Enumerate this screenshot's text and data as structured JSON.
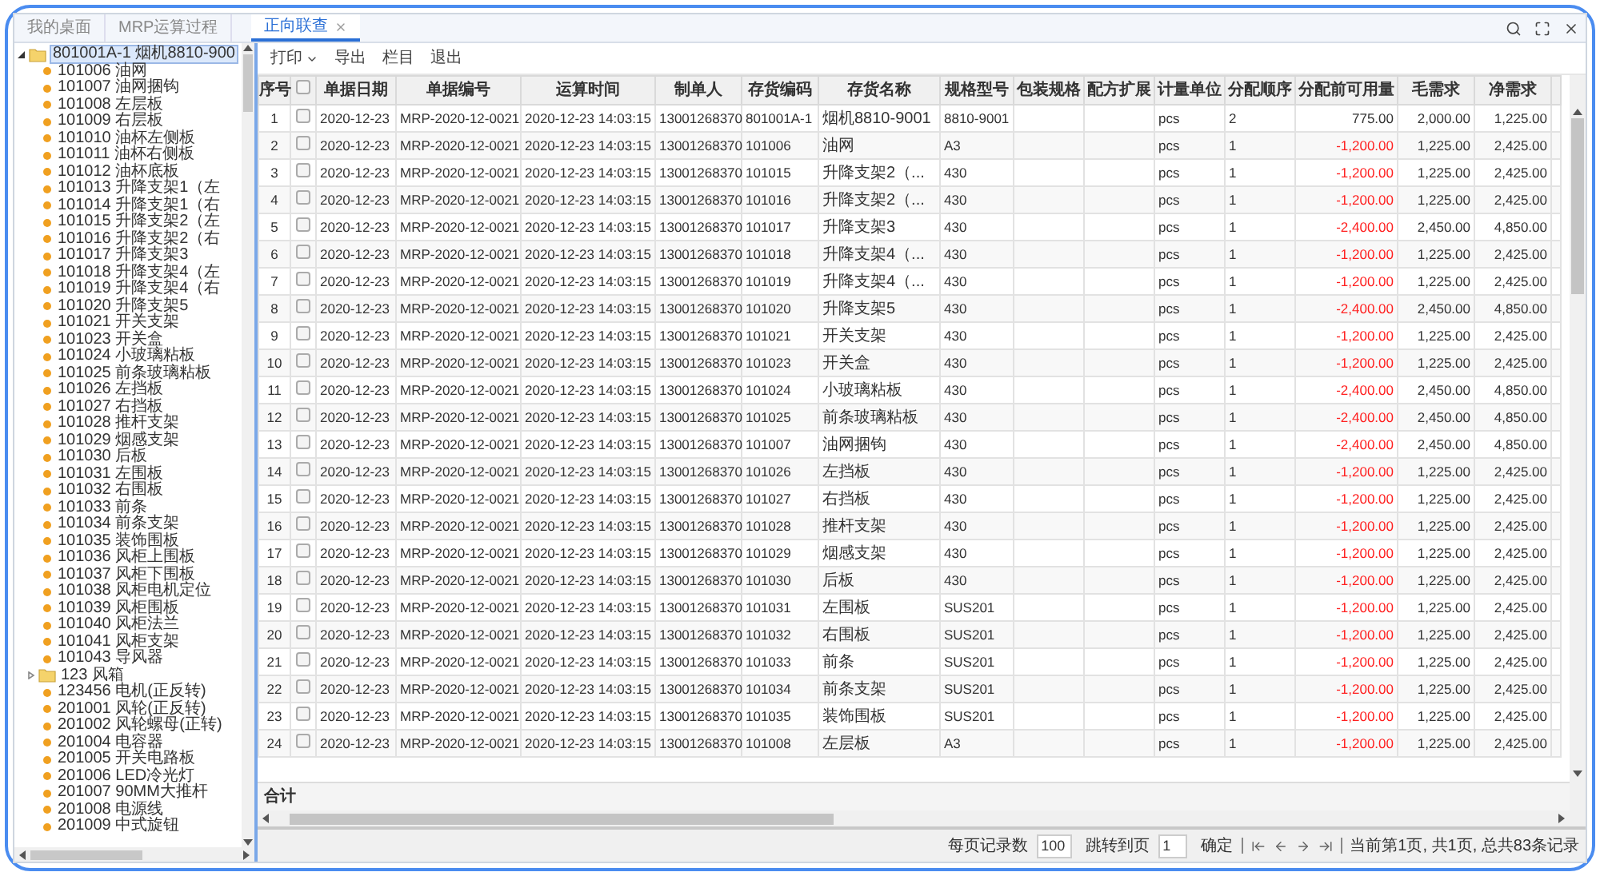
{
  "tabs": [
    {
      "label": "我的桌面",
      "selected": false,
      "closable": false
    },
    {
      "label": "MRP运算过程",
      "selected": false,
      "closable": false
    },
    {
      "label": "正向联查",
      "selected": true,
      "closable": true
    }
  ],
  "toolbar": [
    {
      "label": "打印",
      "dropdown": true
    },
    {
      "label": "导出",
      "dropdown": false
    },
    {
      "label": "栏目",
      "dropdown": false
    },
    {
      "label": "退出",
      "dropdown": false
    }
  ],
  "tree": {
    "label": "801001A-1 烟机8810-900",
    "kind": "folder",
    "expanded": true,
    "selected": true,
    "children": [
      {
        "label": "101006 油网",
        "kind": "item"
      },
      {
        "label": "101007 油网捆钩",
        "kind": "item"
      },
      {
        "label": "101008 左层板",
        "kind": "item"
      },
      {
        "label": "101009 右层板",
        "kind": "item"
      },
      {
        "label": "101010 油杯左侧板",
        "kind": "item"
      },
      {
        "label": "101011 油杯右侧板",
        "kind": "item"
      },
      {
        "label": "101012 油杯底板",
        "kind": "item"
      },
      {
        "label": "101013 升降支架1（左",
        "kind": "item"
      },
      {
        "label": "101014 升降支架1（右",
        "kind": "item"
      },
      {
        "label": "101015 升降支架2（左",
        "kind": "item"
      },
      {
        "label": "101016 升降支架2（右",
        "kind": "item"
      },
      {
        "label": "101017 升降支架3",
        "kind": "item"
      },
      {
        "label": "101018 升降支架4（左",
        "kind": "item"
      },
      {
        "label": "101019 升降支架4（右",
        "kind": "item"
      },
      {
        "label": "101020 升降支架5",
        "kind": "item"
      },
      {
        "label": "101021 开关支架",
        "kind": "item"
      },
      {
        "label": "101023 开关盒",
        "kind": "item"
      },
      {
        "label": "101024 小玻璃粘板",
        "kind": "item"
      },
      {
        "label": "101025 前条玻璃粘板",
        "kind": "item"
      },
      {
        "label": "101026 左挡板",
        "kind": "item"
      },
      {
        "label": "101027 右挡板",
        "kind": "item"
      },
      {
        "label": "101028 推杆支架",
        "kind": "item"
      },
      {
        "label": "101029 烟感支架",
        "kind": "item"
      },
      {
        "label": "101030 后板",
        "kind": "item"
      },
      {
        "label": "101031 左围板",
        "kind": "item"
      },
      {
        "label": "101032 右围板",
        "kind": "item"
      },
      {
        "label": "101033 前条",
        "kind": "item"
      },
      {
        "label": "101034 前条支架",
        "kind": "item"
      },
      {
        "label": "101035 装饰围板",
        "kind": "item"
      },
      {
        "label": "101036 风柜上围板",
        "kind": "item"
      },
      {
        "label": "101037 风柜下围板",
        "kind": "item"
      },
      {
        "label": "101038 风柜电机定位",
        "kind": "item"
      },
      {
        "label": "101039 风柜围板",
        "kind": "item"
      },
      {
        "label": "101040 风柜法兰",
        "kind": "item"
      },
      {
        "label": "101041 风柜支架",
        "kind": "item"
      },
      {
        "label": "101043 导风器",
        "kind": "item"
      },
      {
        "label": "123 风箱",
        "kind": "folder",
        "expanded": false,
        "selected": false
      },
      {
        "label": "123456 电机(正反转)",
        "kind": "item"
      },
      {
        "label": "201001 风轮(正反转)",
        "kind": "item"
      },
      {
        "label": "201002 风轮螺母(正转)",
        "kind": "item"
      },
      {
        "label": "201004 电容器",
        "kind": "item"
      },
      {
        "label": "201005 开关电路板",
        "kind": "item"
      },
      {
        "label": "201006 LED冷光灯",
        "kind": "item"
      },
      {
        "label": "201007 90MM大推杆",
        "kind": "item"
      },
      {
        "label": "201008 电源线",
        "kind": "item"
      },
      {
        "label": "201009 中式旋钮",
        "kind": "item"
      }
    ]
  },
  "table": {
    "columns": [
      "序号",
      "单据日期",
      "单据编号",
      "运算时间",
      "制单人",
      "存货编码",
      "存货名称",
      "规格型号",
      "包装规格",
      "配方扩展",
      "计量单位",
      "分配顺序",
      "分配前可用量",
      "毛需求",
      "净需求"
    ],
    "select_all": {
      "checked": false
    },
    "rows": [
      {
        "no": "1",
        "checked": false,
        "date": "2020-12-23",
        "doc_no": "MRP-2020-12-0021",
        "run_time": "2020-12-23 14:03:15",
        "maker": "13001268370",
        "code": "801001A-1",
        "name": "烟机8810-9001",
        "spec": "8810-9001",
        "unit": "pcs",
        "order": "2",
        "available": "775.00",
        "shortage": false,
        "gross": "2,000.00",
        "net": "1,225.00"
      },
      {
        "no": "2",
        "checked": false,
        "date": "2020-12-23",
        "doc_no": "MRP-2020-12-0021",
        "run_time": "2020-12-23 14:03:15",
        "maker": "13001268370",
        "code": "101006",
        "name": "油网",
        "spec": "A3",
        "unit": "pcs",
        "order": "1",
        "available": "-1,200.00",
        "shortage": true,
        "gross": "1,225.00",
        "net": "2,425.00"
      },
      {
        "no": "3",
        "checked": false,
        "date": "2020-12-23",
        "doc_no": "MRP-2020-12-0021",
        "run_time": "2020-12-23 14:03:15",
        "maker": "13001268370",
        "code": "101015",
        "name": "升降支架2（...",
        "spec": "430",
        "unit": "pcs",
        "order": "1",
        "available": "-1,200.00",
        "shortage": true,
        "gross": "1,225.00",
        "net": "2,425.00"
      },
      {
        "no": "4",
        "checked": false,
        "date": "2020-12-23",
        "doc_no": "MRP-2020-12-0021",
        "run_time": "2020-12-23 14:03:15",
        "maker": "13001268370",
        "code": "101016",
        "name": "升降支架2（...",
        "spec": "430",
        "unit": "pcs",
        "order": "1",
        "available": "-1,200.00",
        "shortage": true,
        "gross": "1,225.00",
        "net": "2,425.00"
      },
      {
        "no": "5",
        "checked": false,
        "date": "2020-12-23",
        "doc_no": "MRP-2020-12-0021",
        "run_time": "2020-12-23 14:03:15",
        "maker": "13001268370",
        "code": "101017",
        "name": "升降支架3",
        "spec": "430",
        "unit": "pcs",
        "order": "1",
        "available": "-2,400.00",
        "shortage": true,
        "gross": "2,450.00",
        "net": "4,850.00"
      },
      {
        "no": "6",
        "checked": false,
        "date": "2020-12-23",
        "doc_no": "MRP-2020-12-0021",
        "run_time": "2020-12-23 14:03:15",
        "maker": "13001268370",
        "code": "101018",
        "name": "升降支架4（...",
        "spec": "430",
        "unit": "pcs",
        "order": "1",
        "available": "-1,200.00",
        "shortage": true,
        "gross": "1,225.00",
        "net": "2,425.00"
      },
      {
        "no": "7",
        "checked": false,
        "date": "2020-12-23",
        "doc_no": "MRP-2020-12-0021",
        "run_time": "2020-12-23 14:03:15",
        "maker": "13001268370",
        "code": "101019",
        "name": "升降支架4（...",
        "spec": "430",
        "unit": "pcs",
        "order": "1",
        "available": "-1,200.00",
        "shortage": true,
        "gross": "1,225.00",
        "net": "2,425.00"
      },
      {
        "no": "8",
        "checked": false,
        "date": "2020-12-23",
        "doc_no": "MRP-2020-12-0021",
        "run_time": "2020-12-23 14:03:15",
        "maker": "13001268370",
        "code": "101020",
        "name": "升降支架5",
        "spec": "430",
        "unit": "pcs",
        "order": "1",
        "available": "-2,400.00",
        "shortage": true,
        "gross": "2,450.00",
        "net": "4,850.00"
      },
      {
        "no": "9",
        "checked": false,
        "date": "2020-12-23",
        "doc_no": "MRP-2020-12-0021",
        "run_time": "2020-12-23 14:03:15",
        "maker": "13001268370",
        "code": "101021",
        "name": "开关支架",
        "spec": "430",
        "unit": "pcs",
        "order": "1",
        "available": "-1,200.00",
        "shortage": true,
        "gross": "1,225.00",
        "net": "2,425.00"
      },
      {
        "no": "10",
        "checked": false,
        "date": "2020-12-23",
        "doc_no": "MRP-2020-12-0021",
        "run_time": "2020-12-23 14:03:15",
        "maker": "13001268370",
        "code": "101023",
        "name": "开关盒",
        "spec": "430",
        "unit": "pcs",
        "order": "1",
        "available": "-1,200.00",
        "shortage": true,
        "gross": "1,225.00",
        "net": "2,425.00"
      },
      {
        "no": "11",
        "checked": false,
        "date": "2020-12-23",
        "doc_no": "MRP-2020-12-0021",
        "run_time": "2020-12-23 14:03:15",
        "maker": "13001268370",
        "code": "101024",
        "name": "小玻璃粘板",
        "spec": "430",
        "unit": "pcs",
        "order": "1",
        "available": "-2,400.00",
        "shortage": true,
        "gross": "2,450.00",
        "net": "4,850.00"
      },
      {
        "no": "12",
        "checked": false,
        "date": "2020-12-23",
        "doc_no": "MRP-2020-12-0021",
        "run_time": "2020-12-23 14:03:15",
        "maker": "13001268370",
        "code": "101025",
        "name": "前条玻璃粘板",
        "spec": "430",
        "unit": "pcs",
        "order": "1",
        "available": "-2,400.00",
        "shortage": true,
        "gross": "2,450.00",
        "net": "4,850.00"
      },
      {
        "no": "13",
        "checked": false,
        "date": "2020-12-23",
        "doc_no": "MRP-2020-12-0021",
        "run_time": "2020-12-23 14:03:15",
        "maker": "13001268370",
        "code": "101007",
        "name": "油网捆钩",
        "spec": "430",
        "unit": "pcs",
        "order": "1",
        "available": "-2,400.00",
        "shortage": true,
        "gross": "2,450.00",
        "net": "4,850.00"
      },
      {
        "no": "14",
        "checked": false,
        "date": "2020-12-23",
        "doc_no": "MRP-2020-12-0021",
        "run_time": "2020-12-23 14:03:15",
        "maker": "13001268370",
        "code": "101026",
        "name": "左挡板",
        "spec": "430",
        "unit": "pcs",
        "order": "1",
        "available": "-1,200.00",
        "shortage": true,
        "gross": "1,225.00",
        "net": "2,425.00"
      },
      {
        "no": "15",
        "checked": false,
        "date": "2020-12-23",
        "doc_no": "MRP-2020-12-0021",
        "run_time": "2020-12-23 14:03:15",
        "maker": "13001268370",
        "code": "101027",
        "name": "右挡板",
        "spec": "430",
        "unit": "pcs",
        "order": "1",
        "available": "-1,200.00",
        "shortage": true,
        "gross": "1,225.00",
        "net": "2,425.00"
      },
      {
        "no": "16",
        "checked": false,
        "date": "2020-12-23",
        "doc_no": "MRP-2020-12-0021",
        "run_time": "2020-12-23 14:03:15",
        "maker": "13001268370",
        "code": "101028",
        "name": "推杆支架",
        "spec": "430",
        "unit": "pcs",
        "order": "1",
        "available": "-1,200.00",
        "shortage": true,
        "gross": "1,225.00",
        "net": "2,425.00"
      },
      {
        "no": "17",
        "checked": false,
        "date": "2020-12-23",
        "doc_no": "MRP-2020-12-0021",
        "run_time": "2020-12-23 14:03:15",
        "maker": "13001268370",
        "code": "101029",
        "name": "烟感支架",
        "spec": "430",
        "unit": "pcs",
        "order": "1",
        "available": "-1,200.00",
        "shortage": true,
        "gross": "1,225.00",
        "net": "2,425.00"
      },
      {
        "no": "18",
        "checked": false,
        "date": "2020-12-23",
        "doc_no": "MRP-2020-12-0021",
        "run_time": "2020-12-23 14:03:15",
        "maker": "13001268370",
        "code": "101030",
        "name": "后板",
        "spec": "430",
        "unit": "pcs",
        "order": "1",
        "available": "-1,200.00",
        "shortage": true,
        "gross": "1,225.00",
        "net": "2,425.00"
      },
      {
        "no": "19",
        "checked": false,
        "date": "2020-12-23",
        "doc_no": "MRP-2020-12-0021",
        "run_time": "2020-12-23 14:03:15",
        "maker": "13001268370",
        "code": "101031",
        "name": "左围板",
        "spec": "SUS201",
        "unit": "pcs",
        "order": "1",
        "available": "-1,200.00",
        "shortage": true,
        "gross": "1,225.00",
        "net": "2,425.00"
      },
      {
        "no": "20",
        "checked": false,
        "date": "2020-12-23",
        "doc_no": "MRP-2020-12-0021",
        "run_time": "2020-12-23 14:03:15",
        "maker": "13001268370",
        "code": "101032",
        "name": "右围板",
        "spec": "SUS201",
        "unit": "pcs",
        "order": "1",
        "available": "-1,200.00",
        "shortage": true,
        "gross": "1,225.00",
        "net": "2,425.00"
      },
      {
        "no": "21",
        "checked": false,
        "date": "2020-12-23",
        "doc_no": "MRP-2020-12-0021",
        "run_time": "2020-12-23 14:03:15",
        "maker": "13001268370",
        "code": "101033",
        "name": "前条",
        "spec": "SUS201",
        "unit": "pcs",
        "order": "1",
        "available": "-1,200.00",
        "shortage": true,
        "gross": "1,225.00",
        "net": "2,425.00"
      },
      {
        "no": "22",
        "checked": false,
        "date": "2020-12-23",
        "doc_no": "MRP-2020-12-0021",
        "run_time": "2020-12-23 14:03:15",
        "maker": "13001268370",
        "code": "101034",
        "name": "前条支架",
        "spec": "SUS201",
        "unit": "pcs",
        "order": "1",
        "available": "-1,200.00",
        "shortage": true,
        "gross": "1,225.00",
        "net": "2,425.00"
      },
      {
        "no": "23",
        "checked": false,
        "date": "2020-12-23",
        "doc_no": "MRP-2020-12-0021",
        "run_time": "2020-12-23 14:03:15",
        "maker": "13001268370",
        "code": "101035",
        "name": "装饰围板",
        "spec": "SUS201",
        "unit": "pcs",
        "order": "1",
        "available": "-1,200.00",
        "shortage": true,
        "gross": "1,225.00",
        "net": "2,425.00"
      },
      {
        "no": "24",
        "checked": false,
        "date": "2020-12-23",
        "doc_no": "MRP-2020-12-0021",
        "run_time": "2020-12-23 14:03:15",
        "maker": "13001268370",
        "code": "101008",
        "name": "左层板",
        "spec": "A3",
        "unit": "pcs",
        "order": "1",
        "available": "-1,200.00",
        "shortage": true,
        "gross": "1,225.00",
        "net": "2,425.00"
      }
    ],
    "summary": {
      "label": "合计"
    }
  },
  "pager": {
    "page_size_label": "每页记录数",
    "page_size": "100",
    "goto_label": "跳转到页",
    "goto_page": "1",
    "confirm": "确定",
    "status": "当前第1页, 共1页, 总共83条记录"
  }
}
